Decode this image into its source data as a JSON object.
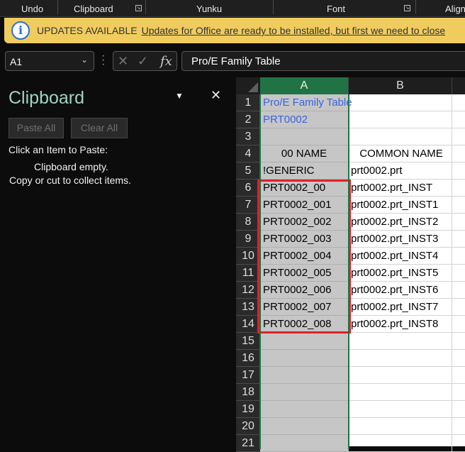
{
  "ribbon": {
    "groups": [
      "Undo",
      "Clipboard",
      "Yunku",
      "Font",
      "Align"
    ]
  },
  "banner": {
    "title": "UPDATES AVAILABLE",
    "message": "Updates for Office are ready to be installed, but first we need to close"
  },
  "formula_bar": {
    "name_box": "A1",
    "formula": "Pro/E Family Table"
  },
  "clipboard_pane": {
    "title": "Clipboard",
    "paste_all": "Paste All",
    "clear_all": "Clear All",
    "instruction": "Click an Item to Paste:",
    "empty": "Clipboard empty.",
    "hint": "Copy or cut to collect items."
  },
  "sheet": {
    "columns": [
      "A",
      "B"
    ],
    "rows": [
      {
        "n": "1",
        "a": "Pro/E Family Table",
        "b": ""
      },
      {
        "n": "2",
        "a": "PRT0002",
        "b": ""
      },
      {
        "n": "3",
        "a": "",
        "b": ""
      },
      {
        "n": "4",
        "a": "00 NAME",
        "b": "COMMON NAME"
      },
      {
        "n": "5",
        "a": "!GENERIC",
        "b": "prt0002.prt"
      },
      {
        "n": "6",
        "a": "PRT0002_00",
        "b": "prt0002.prt_INST"
      },
      {
        "n": "7",
        "a": "PRT0002_001",
        "b": "prt0002.prt_INST1"
      },
      {
        "n": "8",
        "a": "PRT0002_002",
        "b": "prt0002.prt_INST2"
      },
      {
        "n": "9",
        "a": "PRT0002_003",
        "b": "prt0002.prt_INST3"
      },
      {
        "n": "10",
        "a": "PRT0002_004",
        "b": "prt0002.prt_INST4"
      },
      {
        "n": "11",
        "a": "PRT0002_005",
        "b": "prt0002.prt_INST5"
      },
      {
        "n": "12",
        "a": "PRT0002_006",
        "b": "prt0002.prt_INST6"
      },
      {
        "n": "13",
        "a": "PRT0002_007",
        "b": "prt0002.prt_INST7"
      },
      {
        "n": "14",
        "a": "PRT0002_008",
        "b": "prt0002.prt_INST8"
      },
      {
        "n": "15",
        "a": "",
        "b": ""
      },
      {
        "n": "16",
        "a": "",
        "b": ""
      },
      {
        "n": "17",
        "a": "",
        "b": ""
      },
      {
        "n": "18",
        "a": "",
        "b": ""
      },
      {
        "n": "19",
        "a": "",
        "b": ""
      },
      {
        "n": "20",
        "a": "",
        "b": ""
      },
      {
        "n": "21",
        "a": "",
        "b": ""
      }
    ]
  }
}
